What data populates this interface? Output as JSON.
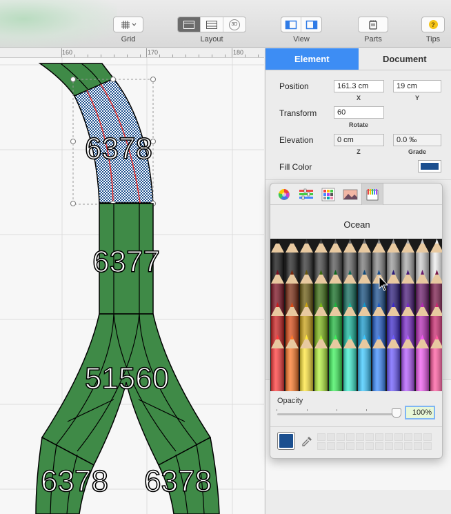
{
  "toolbar": {
    "grid_label": "Grid",
    "layout_label": "Layout",
    "view_label": "View",
    "parts_label": "Parts",
    "tips_label": "Tips",
    "layout_3d_badge": "3D",
    "tips_icon_glyph": "?"
  },
  "ruler": {
    "marks": [
      "160",
      "170",
      "180"
    ]
  },
  "canvas": {
    "track_color": "#3f8a47",
    "selected_color": "#1b4f8f",
    "labels": {
      "top_section": "6378",
      "straight_section": "6377",
      "switch_section": "51560",
      "left_branch": "6378",
      "right_branch": "6378"
    }
  },
  "panel": {
    "tabs": [
      {
        "label": "Element",
        "active": true
      },
      {
        "label": "Document",
        "active": false
      }
    ],
    "position_label": "Position",
    "position_x": "161.3 cm",
    "position_y": "19 cm",
    "x_caption": "X",
    "y_caption": "Y",
    "transform_label": "Transform",
    "rotate_value": "60",
    "rotate_caption": "Rotate",
    "elevation_label": "Elevation",
    "elevation_z": "0 cm",
    "grade_value": "0.0 ‰",
    "z_caption": "Z",
    "grade_caption": "Grade",
    "fill_color_label": "Fill Color",
    "fill_color": "#1b4f8f"
  },
  "colors_popover": {
    "tabs": [
      "color-wheel-icon",
      "color-sliders-icon",
      "color-palettes-icon",
      "image-palettes-icon",
      "crayons-icon"
    ],
    "selected_name": "Ocean",
    "opacity_label": "Opacity",
    "opacity_value": "100%",
    "opacity_fraction": 1.0,
    "current_color": "#1b4f8f"
  }
}
